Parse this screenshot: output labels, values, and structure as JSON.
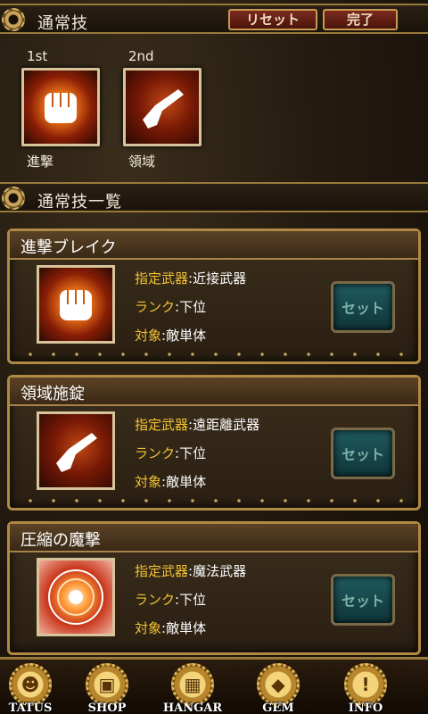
{
  "header": {
    "title": "通常技",
    "reset_label": "リセット",
    "done_label": "完了"
  },
  "equipped": [
    {
      "order": "1st",
      "name": "進撃",
      "icon": "fist-icon"
    },
    {
      "order": "2nd",
      "name": "領域",
      "icon": "pistol-icon"
    }
  ],
  "list_header": {
    "title": "通常技一覧"
  },
  "skills": [
    {
      "name": "進撃ブレイク",
      "weapon_key": "指定武器",
      "weapon": ":近接武器",
      "rank_key": "ランク",
      "rank": ":下位",
      "target_key": "対象",
      "target": ":敵単体",
      "set_label": "セット",
      "icon": "fist-icon"
    },
    {
      "name": "領域施錠",
      "weapon_key": "指定武器",
      "weapon": ":遠距離武器",
      "rank_key": "ランク",
      "rank": ":下位",
      "target_key": "対象",
      "target": ":敵単体",
      "set_label": "セット",
      "icon": "pistol-icon"
    },
    {
      "name": "圧縮の魔撃",
      "weapon_key": "指定武器",
      "weapon": ":魔法武器",
      "rank_key": "ランク",
      "rank": ":下位",
      "target_key": "対象",
      "target": ":敵単体",
      "set_label": "セット",
      "icon": "magic-circle-icon"
    }
  ],
  "nav": [
    {
      "label": "TATUS",
      "icon": "person-icon"
    },
    {
      "label": "SHOP",
      "icon": "cart-icon"
    },
    {
      "label": "HANGAR",
      "icon": "crate-icon"
    },
    {
      "label": "GEM",
      "icon": "gem-icon"
    },
    {
      "label": "INFO",
      "icon": "info-icon"
    }
  ],
  "colors": {
    "accent_gold": "#f2c234",
    "frame": "#b08a44",
    "set_button": "#1f5b60"
  }
}
